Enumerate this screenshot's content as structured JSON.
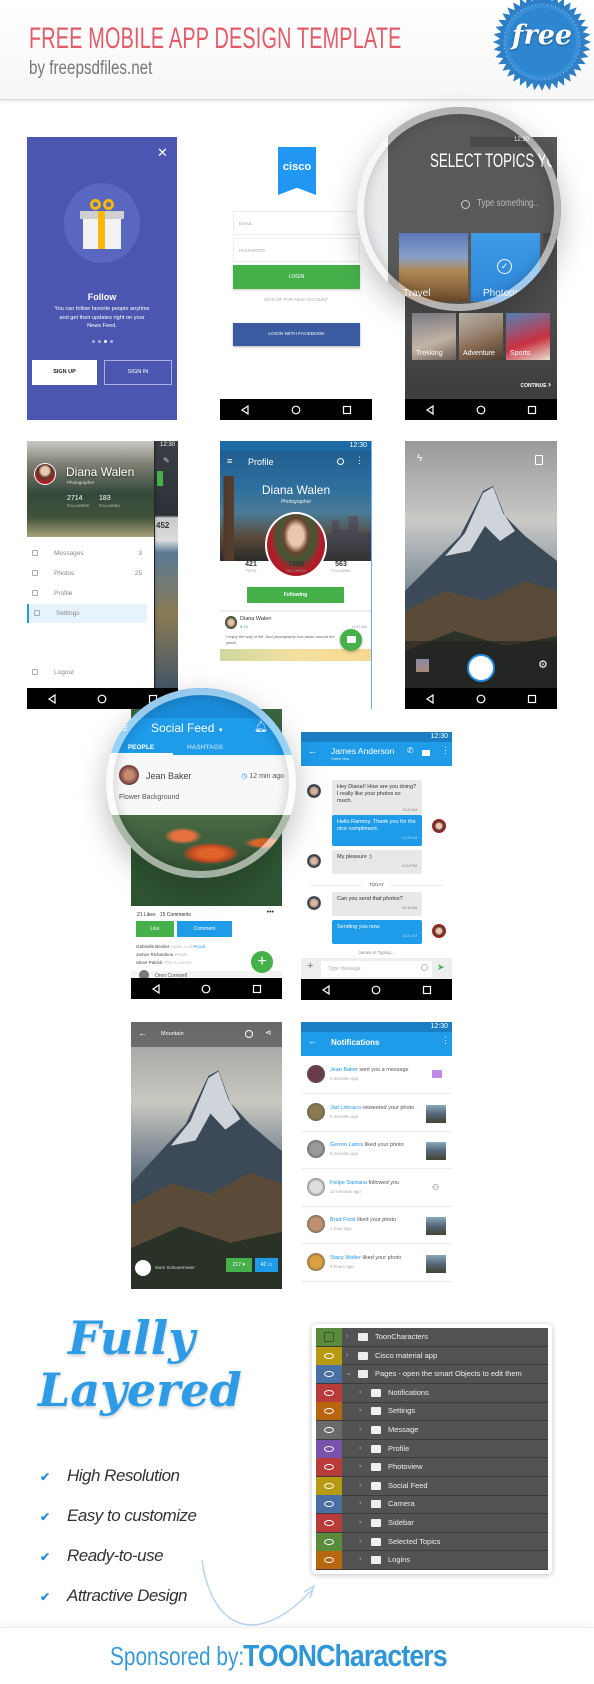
{
  "header": {
    "title": "FREE MOBILE APP DESIGN TEMPLATE",
    "subtitle": "by freepsdfiles.net",
    "badge": "free"
  },
  "colors": {
    "title": "#e25b68",
    "accent_blue": "#1e9be9",
    "green": "#4caf50",
    "onboarding_bg": "#4a56b0",
    "facebook": "#3b5998",
    "badge": "#2f7fc6"
  },
  "screens": {
    "onboarding": {
      "close_icon": "close-icon",
      "title": "Follow",
      "body": [
        "You can follow favorite people anytime",
        "and get their updates right on your",
        "News Feed."
      ],
      "page_count": 4,
      "active_page": 3,
      "sign_up": "SIGN UP",
      "sign_in": "SIGN IN"
    },
    "login": {
      "logo": "cisco",
      "email_placeholder": "EMAIL",
      "password_placeholder": "PASSWORD",
      "login": "LOGIN",
      "signup_link": "SIGN UP FOR NEW ACCOUNT",
      "facebook": "LOGIN WITH FACEBOOK"
    },
    "topics": {
      "time": "12:30",
      "title": "SELECT TOPICS YOU",
      "search_placeholder": "Type something..",
      "tiles": [
        {
          "label": "Travel"
        },
        {
          "label": "Photography",
          "selected": true
        },
        {
          "label": "Trekking"
        },
        {
          "label": "Adventure"
        },
        {
          "label": "Sports"
        }
      ],
      "continue": "CONTINUE"
    },
    "sidebar": {
      "time": "12:30",
      "name": "Diana Walen",
      "role": "Photographer",
      "followers": "2714",
      "followers_label": "FOLLOWERS",
      "following": "183",
      "following_label": "FOLLOWING",
      "items": [
        {
          "label": "Messages",
          "count": "3"
        },
        {
          "label": "Photos",
          "count": "25"
        },
        {
          "label": "Profile",
          "count": ""
        },
        {
          "label": "Settings",
          "count": "",
          "active": true
        }
      ],
      "logout": "Logout",
      "behind_count": "452"
    },
    "profile": {
      "time": "12:30",
      "title": "Profile",
      "name": "Diana Walen",
      "role": "Photographer",
      "stats": [
        {
          "value": "421",
          "label": "POSTS"
        },
        {
          "value": "7589",
          "label": "FOLLOWERS"
        },
        {
          "value": "563",
          "label": "FOLLOWING"
        }
      ],
      "follow_button": "Following",
      "post": {
        "author": "Diana Walen",
        "views": "15",
        "time": "11:57 AM",
        "text": "I enjoy the way of life. And photography has taken around the world."
      }
    },
    "camera": {
      "flash_icon": "flash-icon",
      "switch_icon": "camera-switch-icon",
      "settings_icon": "gear-icon"
    },
    "feed": {
      "title": "Social Feed",
      "tabs": [
        "PEOPLE",
        "HASHTAGS"
      ],
      "active_tab": "PEOPLE",
      "post": {
        "author": "Jean Baker",
        "time": "12 min ago",
        "caption": "Flower Background",
        "likes": "21 Likes",
        "comments": "15 Comments",
        "like_button": "Like",
        "comment_button": "Comment",
        "comment_list": [
          {
            "name": "Gabriella Becker",
            "text": "Looks cool ",
            "tag": "#Cool"
          },
          {
            "name": "James Richardson",
            "text": "Woah!",
            "tag": ""
          },
          {
            "name": "Steve Patrick",
            "text": "This is unreal!",
            "tag": ""
          }
        ]
      },
      "next_author": "Oren Cornwell"
    },
    "chat": {
      "time": "12:30",
      "contact": "James Anderson",
      "status": "Online Now",
      "messages": [
        {
          "dir": "in",
          "text": "Hey Diana!! How are you doing? I really like your photos so much.",
          "time": "11:23 AM"
        },
        {
          "dir": "out",
          "text": "Hello Ramory. Thank you for the nice compliment.",
          "time": "11:25 AM"
        },
        {
          "dir": "in",
          "text": "My pleasure :)",
          "time": "01:15 PM"
        },
        {
          "dir": "in",
          "text": "Can you send that photos?",
          "time": "09:18 AM"
        },
        {
          "dir": "out",
          "text": "Sending you now.",
          "time": "10:21 AM"
        }
      ],
      "divider": "TODAY",
      "typing": "James in Typing...",
      "input_placeholder": "Type message"
    },
    "photoview": {
      "title": "Mountain",
      "author": "Sven Scheuermeier",
      "likes": "217",
      "comments": "42"
    },
    "notifications": {
      "time": "12:30",
      "title": "Notifications",
      "items": [
        {
          "name": "Jean Baker",
          "action": "sent you a message",
          "time": "5 minutes ago",
          "kind": "message"
        },
        {
          "name": "Jad Limcaco",
          "action": "retweeted your photo",
          "time": "6 minutes ago",
          "kind": "photo"
        },
        {
          "name": "Gerren Lamis",
          "action": "liked your photo",
          "time": "9 minutes ago",
          "kind": "photo"
        },
        {
          "name": "Felipe Santana",
          "action": "followed you",
          "time": "12 minutes ago",
          "kind": "follow"
        },
        {
          "name": "Brad Frost",
          "action": "liked your photo",
          "time": "1 hour ago",
          "kind": "photo"
        },
        {
          "name": "Stacy Walter",
          "action": "liked your photo",
          "time": "3 hours ago",
          "kind": "photo"
        }
      ]
    }
  },
  "features": {
    "heading": [
      "Fully",
      "Layered"
    ],
    "items": [
      "High Resolution",
      "Easy to customize",
      "Ready-to-use",
      "Attractive Design"
    ]
  },
  "layers": [
    {
      "name": "ToonCharacters",
      "level": 0,
      "color": "#5b8a3c",
      "visible": false
    },
    {
      "name": "Cisco material app",
      "level": 0,
      "color": "#b89a12",
      "visible": true
    },
    {
      "name": "Pages - open the smart Objects to edit them",
      "level": 0,
      "color": "#4a6fa2",
      "visible": true,
      "expanded": true
    },
    {
      "name": "Notifications",
      "level": 1,
      "color": "#b83b3b",
      "visible": true
    },
    {
      "name": "Settings",
      "level": 1,
      "color": "#b8660f",
      "visible": true
    },
    {
      "name": "Message",
      "level": 1,
      "color": "#6a6a6a",
      "visible": true
    },
    {
      "name": "Profile",
      "level": 1,
      "color": "#7a52aa",
      "visible": true
    },
    {
      "name": "Photoview",
      "level": 1,
      "color": "#b83b3b",
      "visible": true
    },
    {
      "name": "Social Feed",
      "level": 1,
      "color": "#b89a12",
      "visible": true
    },
    {
      "name": "Camera",
      "level": 1,
      "color": "#4a6fa2",
      "visible": true
    },
    {
      "name": "Sidebar",
      "level": 1,
      "color": "#b83b3b",
      "visible": true
    },
    {
      "name": "Selected Topics",
      "level": 1,
      "color": "#5b8a3c",
      "visible": true
    },
    {
      "name": "Logins",
      "level": 1,
      "color": "#b8660f",
      "visible": true
    }
  ],
  "sponsor": {
    "label": "Sponsored by:",
    "brand": "TOONCharacters"
  }
}
